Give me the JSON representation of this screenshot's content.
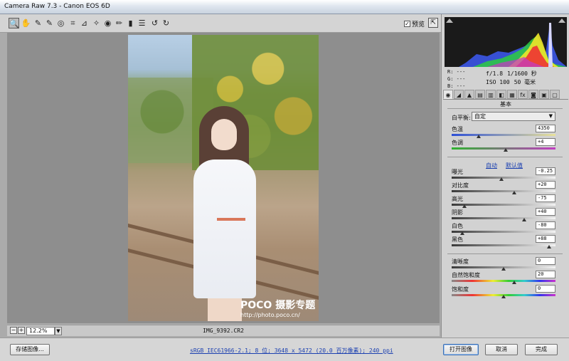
{
  "window": {
    "title": "Camera Raw 7.3  -  Canon EOS 6D"
  },
  "toolbar": {
    "tools": [
      {
        "name": "zoom-tool-icon",
        "glyph": "🔍",
        "active": true
      },
      {
        "name": "hand-tool-icon",
        "glyph": "✋"
      },
      {
        "name": "white-balance-tool-icon",
        "glyph": "✎"
      },
      {
        "name": "color-sampler-tool-icon",
        "glyph": "✎"
      },
      {
        "name": "target-adjustment-tool-icon",
        "glyph": "◎"
      },
      {
        "name": "crop-tool-icon",
        "glyph": "⌗"
      },
      {
        "name": "straighten-tool-icon",
        "glyph": "⊿"
      },
      {
        "name": "spot-removal-tool-icon",
        "glyph": "✧"
      },
      {
        "name": "red-eye-tool-icon",
        "glyph": "◉"
      },
      {
        "name": "adjustment-brush-icon",
        "glyph": "✏"
      },
      {
        "name": "graduated-filter-icon",
        "glyph": "▮"
      },
      {
        "name": "preferences-icon",
        "glyph": "☰"
      },
      {
        "name": "rotate-left-icon",
        "glyph": "↺"
      },
      {
        "name": "rotate-right-icon",
        "glyph": "↻"
      }
    ],
    "preview_label": "预览",
    "preview_checked": "✓"
  },
  "canvas": {
    "watermark_title": "POCO 摄影专题",
    "watermark_url": "http://photo.poco.cn/"
  },
  "zoom": {
    "minus": "−",
    "plus": "+",
    "level": "12.2%",
    "filename": "IMG_9392.CR2"
  },
  "bottom": {
    "save_label": "存储图像...",
    "workflow": "sRGB IEC61966-2.1; 8 位; 3648 x 5472 (20.0 百万像素); 240 ppi",
    "open_label": "打开图像",
    "cancel_label": "取消",
    "done_label": "完成"
  },
  "panel": {
    "rgb": [
      "R:  ---",
      "G:  ---",
      "B:  ---"
    ],
    "exif": {
      "aperture": "f/1.8",
      "shutter": "1/1600 秒",
      "iso": "ISO 100",
      "focal": "50 毫米"
    },
    "tabs": [
      "◉",
      "◢",
      "▲",
      "▤",
      "▥",
      "◧",
      "▦",
      "fx",
      "◙",
      "▣",
      "▢"
    ],
    "section_title": "基本",
    "wb_label": "白平衡:",
    "wb_value": "自定",
    "auto_label": "自动",
    "default_label": "默认值",
    "sliders": [
      {
        "key": "temp",
        "label": "色温",
        "value": "4350",
        "pos": 0.26,
        "track": "temp"
      },
      {
        "key": "tint",
        "label": "色调",
        "value": "+4",
        "pos": 0.52,
        "track": "tint"
      },
      {
        "key": "exposure",
        "label": "曝光",
        "value": "-0.25",
        "pos": 0.48,
        "track": "gray"
      },
      {
        "key": "contrast",
        "label": "对比度",
        "value": "+20",
        "pos": 0.6,
        "track": "gray"
      },
      {
        "key": "highlights",
        "label": "高光",
        "value": "-75",
        "pos": 0.12,
        "track": "gray"
      },
      {
        "key": "shadows",
        "label": "阴影",
        "value": "+40",
        "pos": 0.7,
        "track": "gray"
      },
      {
        "key": "whites",
        "label": "白色",
        "value": "-80",
        "pos": 0.1,
        "track": "gray"
      },
      {
        "key": "blacks",
        "label": "黑色",
        "value": "+88",
        "pos": 0.94,
        "track": "gray"
      },
      {
        "key": "clarity",
        "label": "清晰度",
        "value": "0",
        "pos": 0.5,
        "track": "gray"
      },
      {
        "key": "vibrance",
        "label": "自然饱和度",
        "value": "20",
        "pos": 0.6,
        "track": "sat"
      },
      {
        "key": "saturation",
        "label": "饱和度",
        "value": "0",
        "pos": 0.5,
        "track": "sat"
      }
    ]
  }
}
